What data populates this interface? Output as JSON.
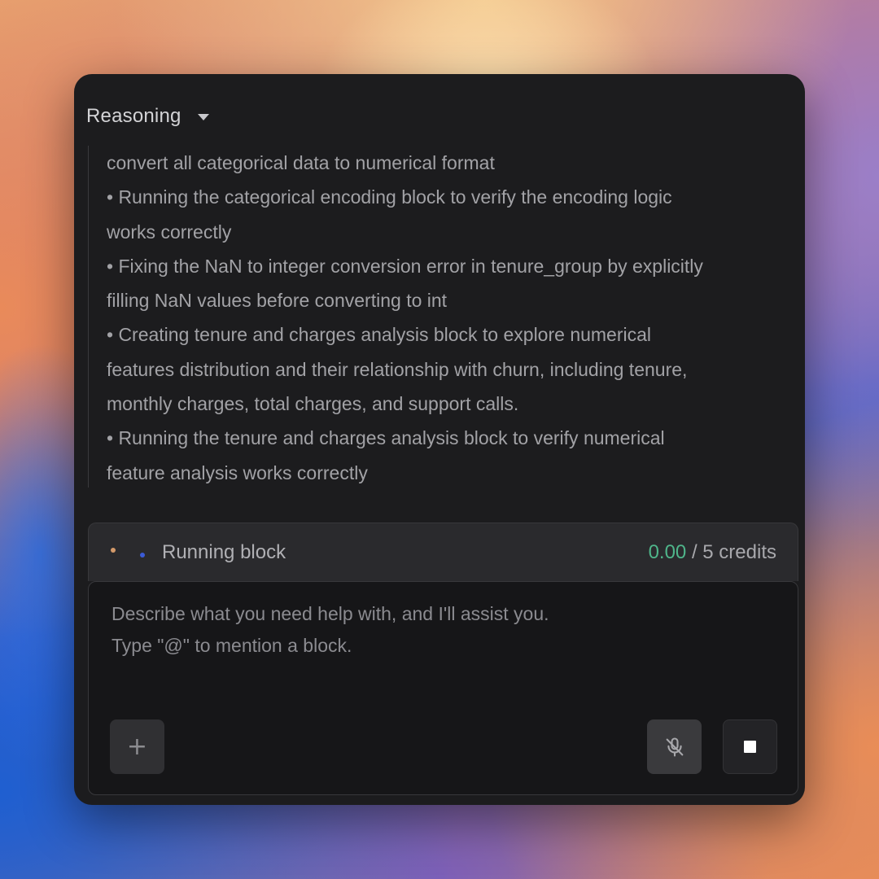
{
  "reasoning": {
    "title": "Reasoning",
    "lines": [
      "convert all categorical data to numerical format",
      "• Running the categorical encoding block to verify the encoding logic",
      "works correctly",
      "• Fixing the NaN to integer conversion error in tenure_group by explicitly",
      "filling NaN values before converting to int",
      "• Creating tenure and charges analysis block to explore numerical",
      "features distribution and their relationship with churn, including tenure,",
      "monthly charges, total charges, and support calls.",
      "• Running the tenure and charges analysis block to verify numerical",
      "feature analysis works correctly"
    ]
  },
  "status": {
    "label": "Running block",
    "credits_used": "0.00",
    "credits_suffix": " / 5 credits"
  },
  "input": {
    "placeholder_line1": "Describe what you need help with, and I'll assist you.",
    "placeholder_line2": "Type \"@\" to mention a block."
  },
  "buttons": {
    "add_icon": "plus-icon",
    "mic_icon": "mic-off-icon",
    "stop_icon": "stop-icon"
  },
  "colors": {
    "panel_bg": "#1c1c1e",
    "credits_accent": "#4fb58a"
  }
}
